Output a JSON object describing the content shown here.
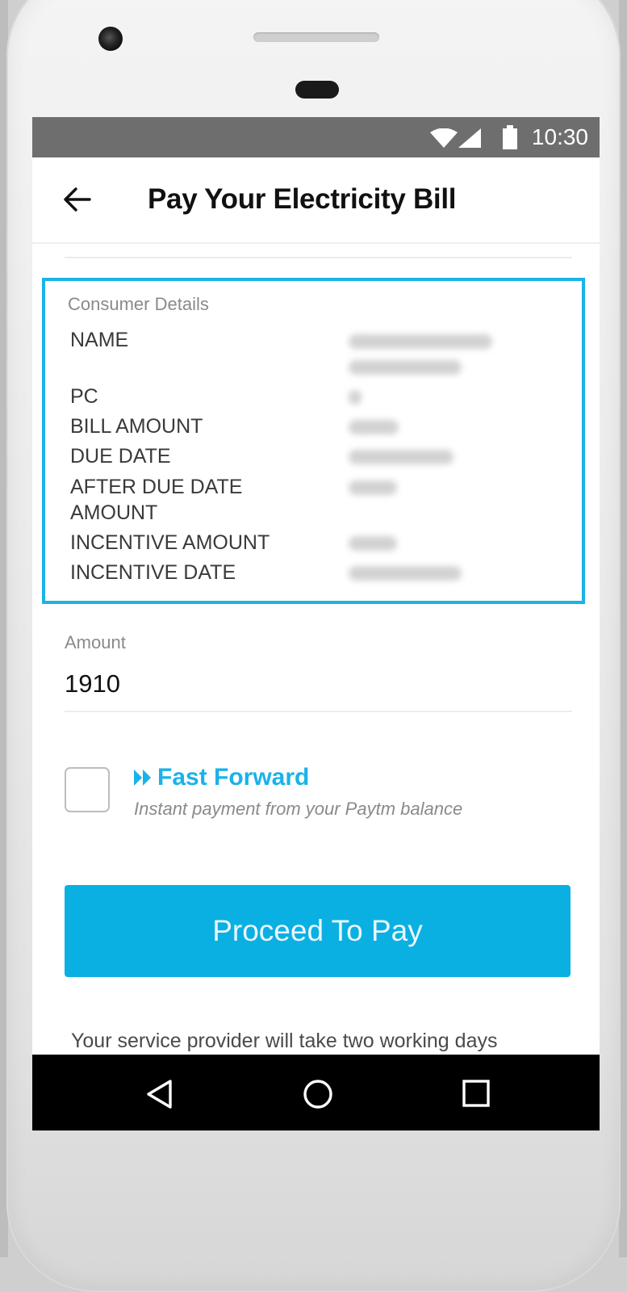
{
  "status": {
    "time": "10:30",
    "icons": [
      "wifi-icon",
      "signal-icon",
      "battery-icon"
    ]
  },
  "header": {
    "title": "Pay Your Electricity Bill",
    "back_icon": "arrow-left-icon"
  },
  "consumer_details": {
    "heading": "Consumer Details",
    "rows": [
      {
        "label": "NAME",
        "value_hidden": true
      },
      {
        "label": "PC",
        "value_hidden": true
      },
      {
        "label": "BILL AMOUNT",
        "value_hidden": true
      },
      {
        "label": "DUE DATE",
        "value_hidden": true
      },
      {
        "label": "AFTER DUE DATE\nAMOUNT",
        "value_hidden": true
      },
      {
        "label": "INCENTIVE AMOUNT",
        "value_hidden": true
      },
      {
        "label": "INCENTIVE DATE",
        "value_hidden": true
      }
    ],
    "border_color": "#1bb3e8"
  },
  "amount": {
    "label": "Amount",
    "value": "1910"
  },
  "fast_forward": {
    "checked": false,
    "title": "Fast Forward",
    "subtitle": "Instant payment from your Paytm balance",
    "icon": "fast-forward-icon",
    "color": "#1ab2e8"
  },
  "pay_button": {
    "label": "Proceed To Pay",
    "color": "#0bb0e2"
  },
  "footer_note": "Your service provider will take two working days",
  "nav": {
    "icons": [
      "nav-back-icon",
      "nav-home-icon",
      "nav-recent-icon"
    ]
  }
}
